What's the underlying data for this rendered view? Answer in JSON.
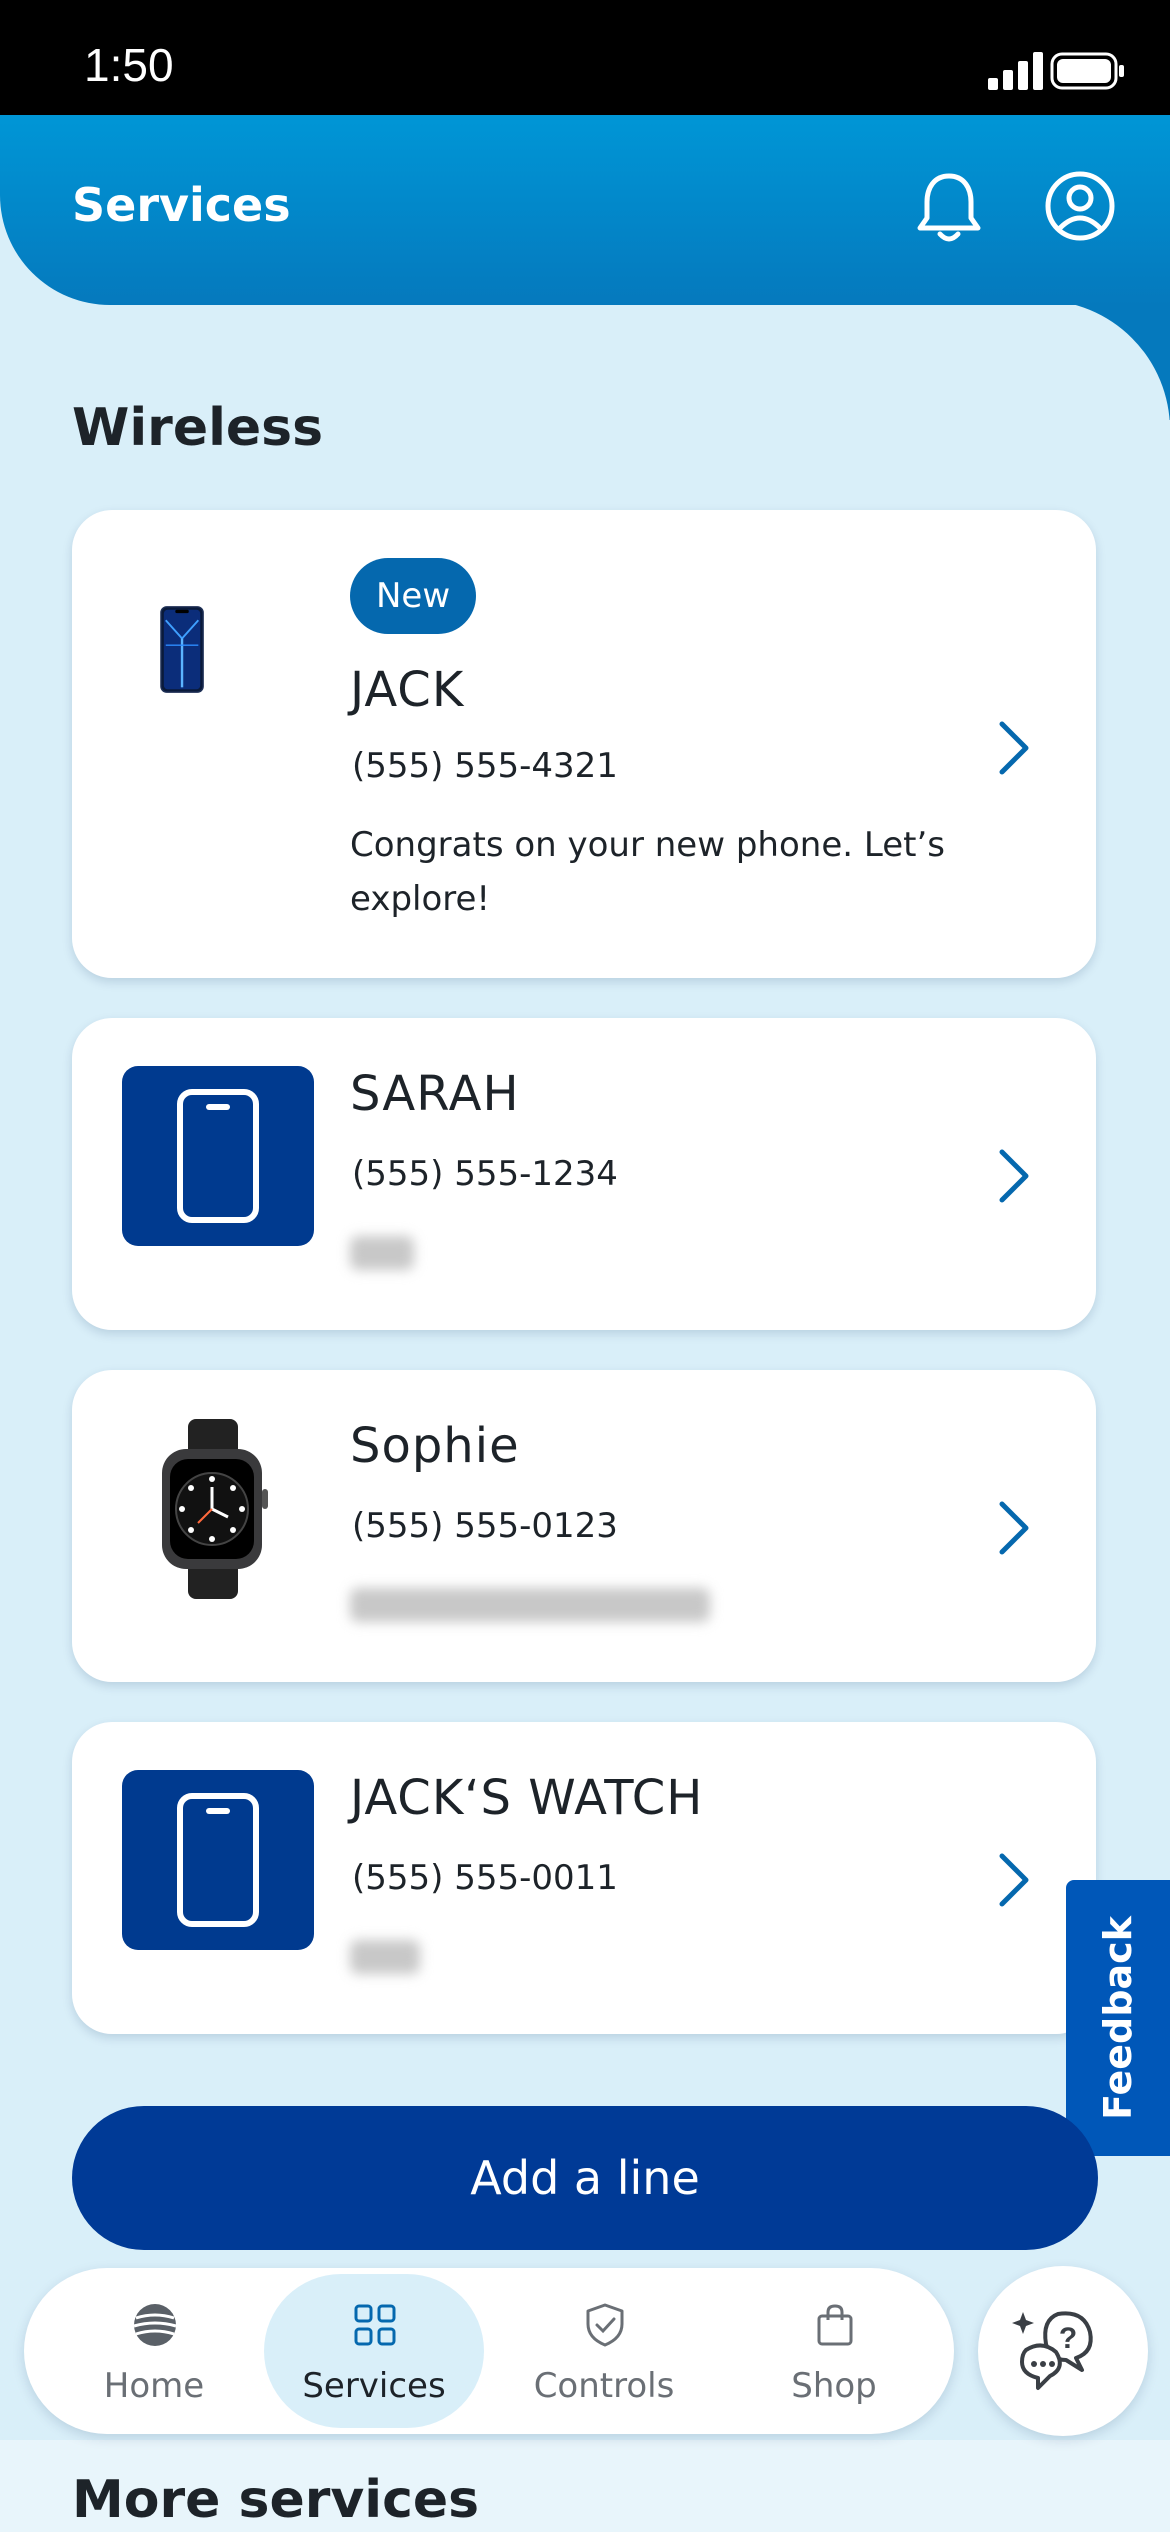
{
  "status_bar": {
    "time": "1:50"
  },
  "header": {
    "title": "Services"
  },
  "wireless": {
    "section_title": "Wireless",
    "lines": [
      {
        "badge": "New",
        "name": "JACK",
        "phone": "(555) 555-4321",
        "message": "Congrats on your new phone. Let’s explore!",
        "image": "iphone-image"
      },
      {
        "name": "SARAH",
        "phone": "(555) 555-1234",
        "image": "phone-icon"
      },
      {
        "name": "Sophie",
        "phone": "(555) 555-0123",
        "image": "watch-image"
      },
      {
        "name": "JACK‘S WATCH",
        "phone": "(555) 555-0011",
        "image": "phone-icon"
      }
    ],
    "add_line_label": "Add a line"
  },
  "feedback_label": "Feedback",
  "tabbar": {
    "tabs": [
      {
        "label": "Home",
        "icon": "att-globe-icon",
        "active": false
      },
      {
        "label": "Services",
        "icon": "grid-icon",
        "active": true
      },
      {
        "label": "Controls",
        "icon": "shield-check-icon",
        "active": false
      },
      {
        "label": "Shop",
        "icon": "shopping-bag-icon",
        "active": false
      }
    ]
  },
  "chat_icon": "chat-help-icon",
  "more_services_title": "More services",
  "colors": {
    "header": "#0096d6",
    "accent": "#0568ae",
    "navy": "#003a96",
    "background": "#d9eff9"
  }
}
